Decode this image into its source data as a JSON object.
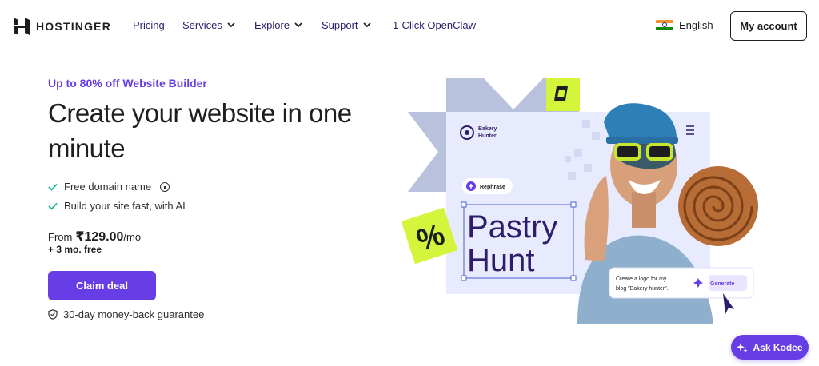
{
  "brand": {
    "name": "HOSTINGER"
  },
  "nav": {
    "items": [
      {
        "label": "Pricing",
        "has_chevron": false
      },
      {
        "label": "Services",
        "has_chevron": true
      },
      {
        "label": "Explore",
        "has_chevron": true
      },
      {
        "label": "Support",
        "has_chevron": true
      },
      {
        "label": "1-Click OpenClaw",
        "has_chevron": false
      }
    ],
    "language": "English",
    "account_button": "My account"
  },
  "hero": {
    "promo": "Up to 80% off Website Builder",
    "headline": "Create your website in one minute",
    "features": [
      {
        "label": "Free domain name",
        "info_icon": true
      },
      {
        "label": "Build your site fast, with AI",
        "info_icon": false
      }
    ],
    "price_prefix": "From",
    "price": "₹129.00",
    "price_suffix": "/mo",
    "bonus": "+ 3 mo. free",
    "cta": "Claim deal",
    "guarantee": "30-day money-back guarantee"
  },
  "illustration": {
    "site_name_line1": "Bakery",
    "site_name_line2": "Hunter",
    "rephrase_label": "Rephrase",
    "hero_word_1": "Pastry",
    "hero_word_2": "Hunt",
    "percent_badge": "%",
    "prompt_line1": "Create a logo for my",
    "prompt_line2": "blog \"Bakery hunter\".",
    "generate_label": "Generate"
  },
  "assistant": {
    "label": "Ask Kodee"
  },
  "colors": {
    "accent": "#673de6",
    "lime": "#d5f53d",
    "illustration_bg": "#e8eafd",
    "shape_gray": "#b9c2dc"
  }
}
